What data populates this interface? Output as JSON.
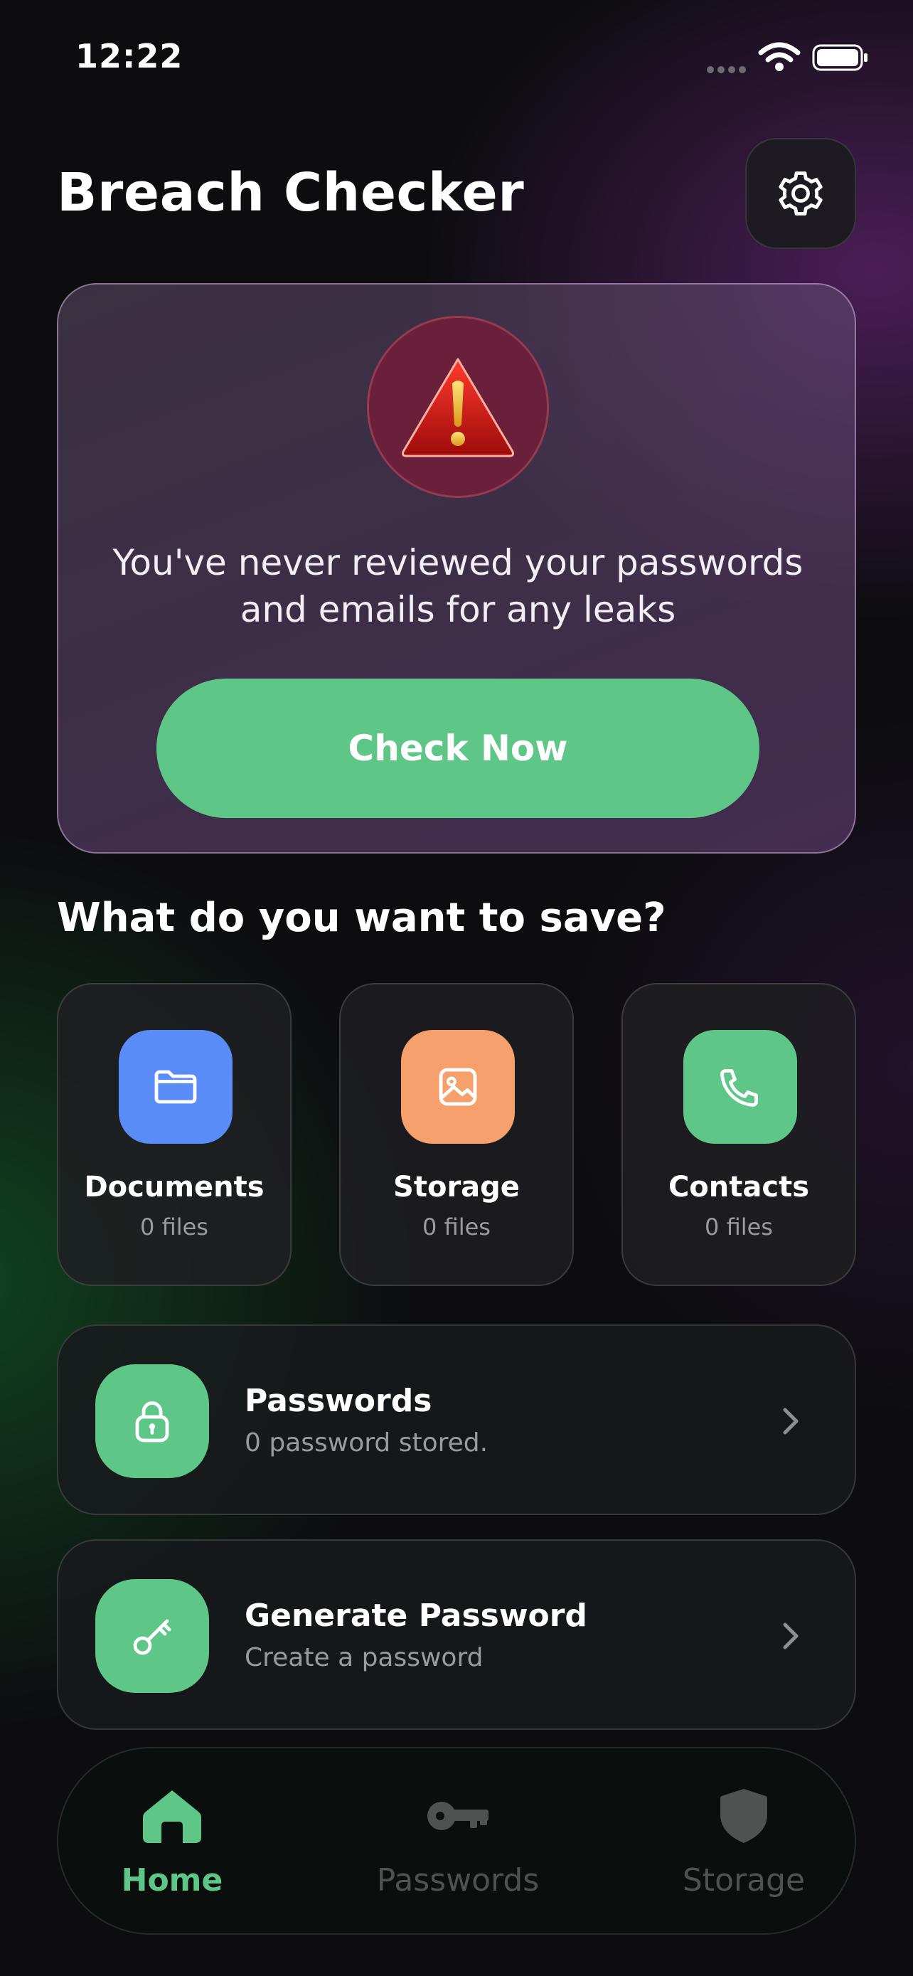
{
  "status_bar": {
    "time": "12:22"
  },
  "header": {
    "title": "Breach Checker",
    "settings_icon": "gear-icon"
  },
  "alert": {
    "icon": "warning-triangle-icon",
    "message": "You've never reviewed your passwords and emails for any leaks",
    "button_label": "Check Now"
  },
  "save_section": {
    "title": "What do you want to save?",
    "tiles": [
      {
        "label": "Documents",
        "count": "0 files",
        "icon": "folder-icon",
        "color": "#5a8cf8"
      },
      {
        "label": "Storage",
        "count": "0 files",
        "icon": "image-icon",
        "color": "#f6a06c"
      },
      {
        "label": "Contacts",
        "count": "0 files",
        "icon": "phone-icon",
        "color": "#5ec687"
      }
    ]
  },
  "rows": [
    {
      "title": "Passwords",
      "subtitle": "0 password stored.",
      "icon": "lock-icon"
    },
    {
      "title": "Generate Password",
      "subtitle": "Create a password",
      "icon": "key-icon"
    }
  ],
  "nav": {
    "items": [
      {
        "label": "Home",
        "icon": "home-icon",
        "active": true
      },
      {
        "label": "Passwords",
        "icon": "key-icon",
        "active": false
      },
      {
        "label": "Storage",
        "icon": "shield-icon",
        "active": false
      }
    ],
    "active_color": "#5ec687",
    "inactive_color": "#4e5251"
  },
  "colors": {
    "accent": "#5ec687",
    "alert_circle": "#6a1f3a"
  }
}
